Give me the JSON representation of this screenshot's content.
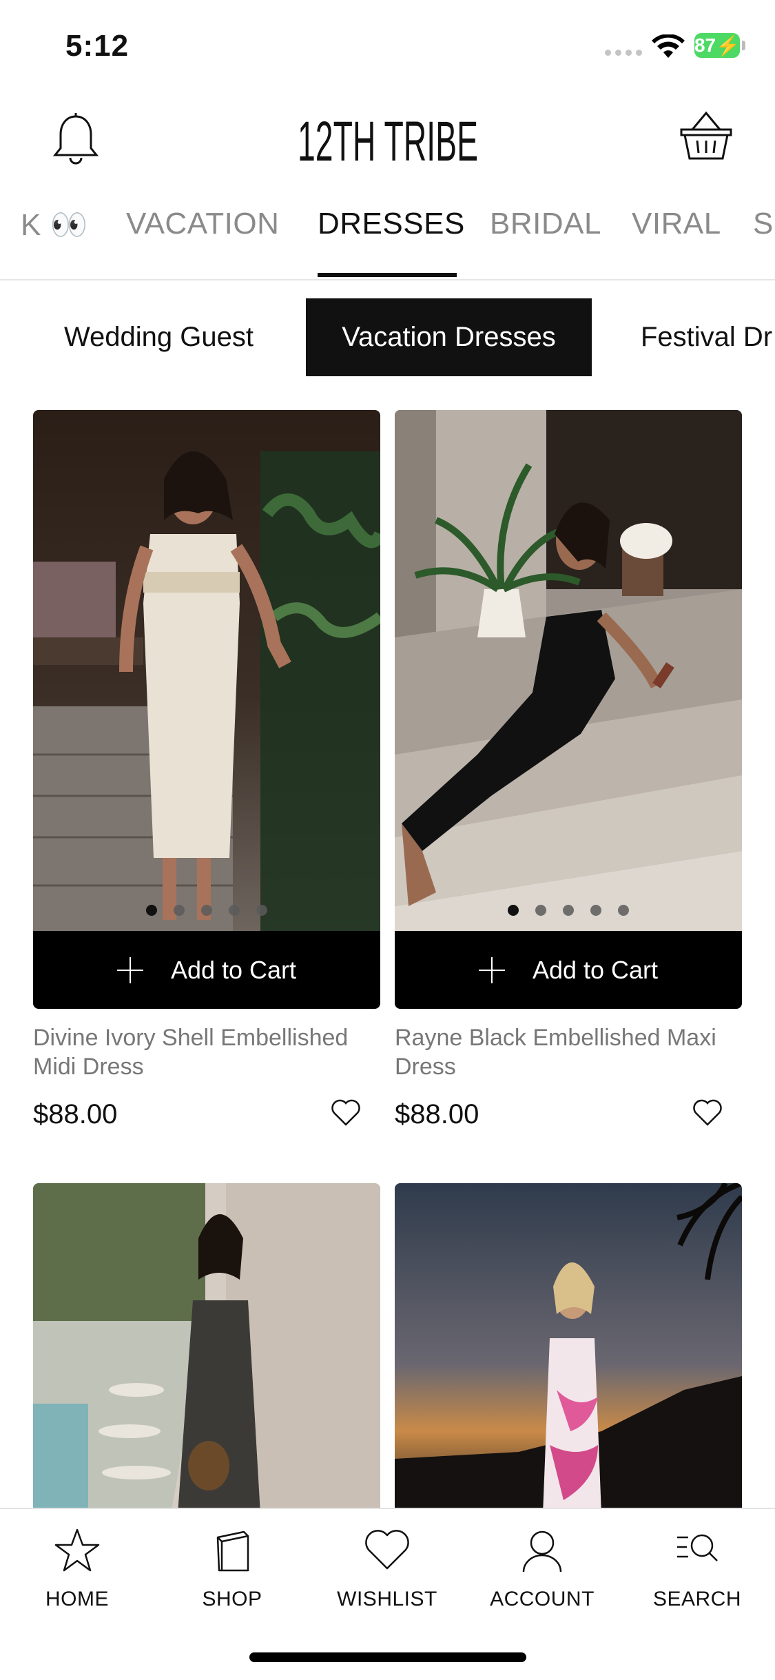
{
  "status_bar": {
    "time": "5:12",
    "battery": "87"
  },
  "header": {
    "brand": "12TH TRIBE"
  },
  "category_tabs": [
    {
      "label": "K 👀",
      "active": false
    },
    {
      "label": "VACATION",
      "active": false
    },
    {
      "label": "DRESSES",
      "active": true
    },
    {
      "label": "BRIDAL",
      "active": false
    },
    {
      "label": "VIRAL",
      "active": false
    },
    {
      "label": "S",
      "active": false
    }
  ],
  "sub_tabs": [
    {
      "label": "Wedding Guest",
      "active": false
    },
    {
      "label": "Vacation Dresses",
      "active": true
    },
    {
      "label": "Festival Dr",
      "active": false
    }
  ],
  "add_to_cart_label": "Add to Cart",
  "products": [
    {
      "name": "Divine Ivory Shell Embellished Midi Dress",
      "price": "$88.00",
      "image_dots": 5,
      "active_dot": 1
    },
    {
      "name": "Rayne Black Embellished Maxi Dress",
      "price": "$88.00",
      "image_dots": 5,
      "active_dot": 1
    }
  ],
  "bottom_nav": [
    {
      "label": "HOME",
      "icon": "star-icon"
    },
    {
      "label": "SHOP",
      "icon": "shopping-bag-icon"
    },
    {
      "label": "WISHLIST",
      "icon": "heart-icon"
    },
    {
      "label": "ACCOUNT",
      "icon": "user-icon"
    },
    {
      "label": "SEARCH",
      "icon": "search-list-icon"
    }
  ],
  "colors": {
    "accent": "#111111",
    "battery": "#4cd964",
    "muted_text": "#777777"
  }
}
